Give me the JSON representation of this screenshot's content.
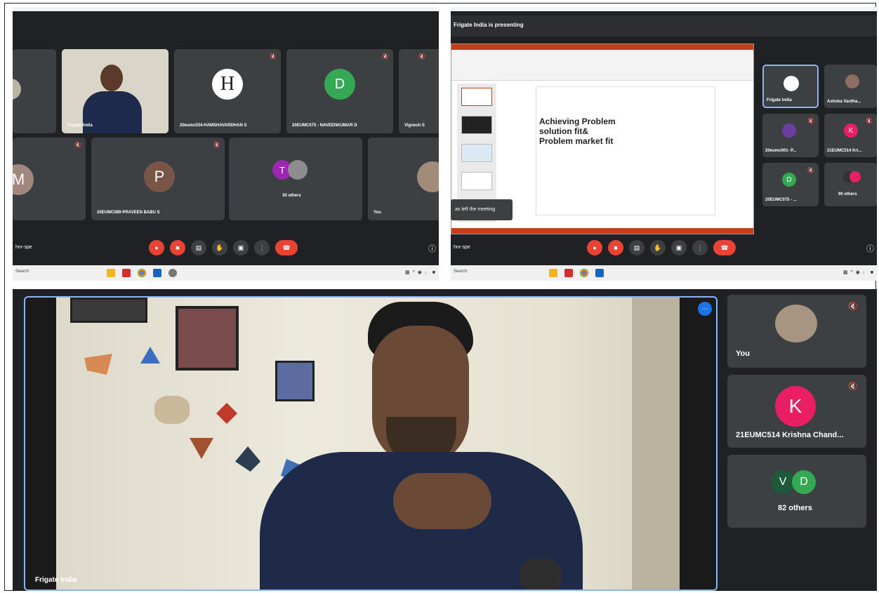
{
  "left_screenshot": {
    "tiles": [
      {
        "name": "",
        "avatar": ""
      },
      {
        "name": "Frigate India",
        "avatar": ""
      },
      {
        "name": "20eumc034-HAMSHAVARDHAN S",
        "avatar": "H"
      },
      {
        "name": "20EUMC075 - NAVEENKUMAR D",
        "avatar": "D"
      },
      {
        "name": "Vignesh S",
        "avatar": ""
      },
      {
        "name": "",
        "avatar": "M"
      },
      {
        "name": "20EUMC089-PRAVEEN BABU S",
        "avatar": "P"
      },
      {
        "name": "30 others",
        "avatar": "T"
      },
      {
        "name": "You",
        "avatar": ""
      }
    ],
    "meeting_code": "hnr-spe",
    "taskbar_search": "Search"
  },
  "right_screenshot": {
    "presenting_text": "Frigate India is presenting",
    "slide_title": "Achieving Problem\nsolution fit&\nProblem market fit",
    "toast": "as left the meeting",
    "tiles": [
      {
        "name": "Frigate India",
        "avatar": ""
      },
      {
        "name": "Ashoka Vardha...",
        "avatar": ""
      },
      {
        "name": "20eumc001- P...",
        "avatar": ""
      },
      {
        "name": "21EUMC514 Kri...",
        "avatar": "K"
      },
      {
        "name": "20EUMC075 - ...",
        "avatar": "D"
      },
      {
        "name": "90 others",
        "avatar": ""
      }
    ],
    "meeting_code": "hnr-spe",
    "taskbar_search": "Search"
  },
  "bottom_view": {
    "main_speaker_name": "Frigate India",
    "side_tiles": [
      {
        "name": "You",
        "avatar": ""
      },
      {
        "name": "21EUMC514 Krishna Chand...",
        "avatar": "K"
      },
      {
        "name": "82 others",
        "avatars": [
          "V",
          "D"
        ]
      }
    ]
  },
  "colors": {
    "meet_bg": "#202124",
    "tile_bg": "#3c4043",
    "end_call_red": "#ea4335",
    "active_border": "#8ab4f8",
    "avatar_green": "#34a853",
    "avatar_pink": "#e91e63",
    "avatar_brown": "#795548"
  },
  "icons": [
    "mic-off-icon",
    "camera-off-icon",
    "captions-icon",
    "raise-hand-icon",
    "present-icon",
    "more-options-icon",
    "end-call-icon",
    "info-icon",
    "windows-search-icon"
  ]
}
